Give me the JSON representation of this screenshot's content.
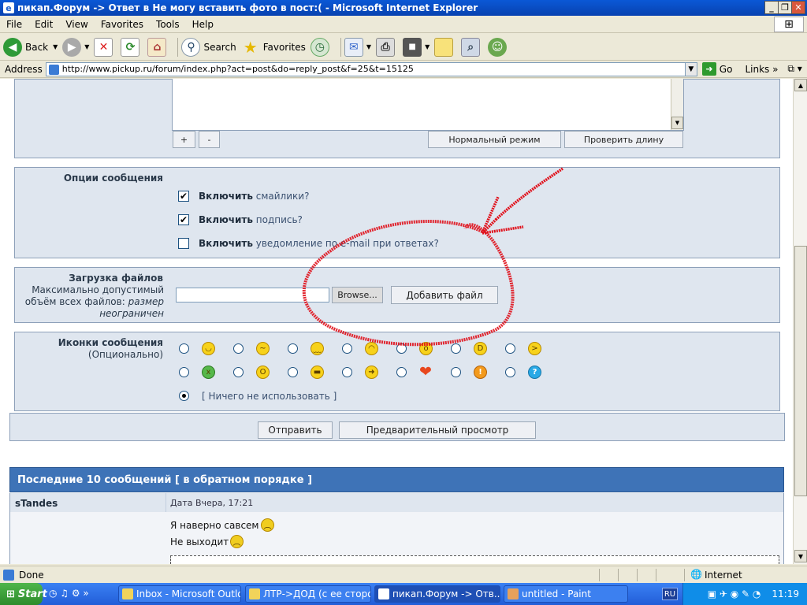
{
  "window": {
    "title": "пикап.Форум -> Ответ в Не могу вставить фото в пост:( - Microsoft Internet Explorer",
    "controls": [
      "_",
      "❐",
      "✕"
    ]
  },
  "menu": [
    "File",
    "Edit",
    "View",
    "Favorites",
    "Tools",
    "Help"
  ],
  "toolbar": {
    "back": "Back",
    "search": "Search",
    "favorites": "Favorites"
  },
  "address": {
    "label": "Address",
    "url": "http://www.pickup.ru/forum/index.php?act=post&do=reply_post&f=25&t=15125",
    "go": "Go",
    "links": "Links"
  },
  "editor": {
    "plus": "+",
    "minus": "-",
    "normal_mode": "Нормальный режим",
    "check_length": "Проверить длину"
  },
  "options": {
    "title": "Опции сообщения",
    "items": [
      {
        "bold": "Включить",
        "rest": " смайлики?",
        "checked": true
      },
      {
        "bold": "Включить",
        "rest": " подпись?",
        "checked": true
      },
      {
        "bold": "Включить",
        "rest": " уведомление по e-mail при ответах?",
        "checked": false
      }
    ]
  },
  "upload": {
    "title": "Загрузка файлов",
    "desc1": "Максимально допустимый",
    "desc2": "объём всех файлов:",
    "desc2_em": "размер",
    "desc3": "неограничен",
    "browse": "Browse...",
    "add": "Добавить файл"
  },
  "icons": {
    "title": "Иконки сообщения",
    "subtitle": "(Опционально)",
    "none": "[ Ничего не использовать ]"
  },
  "submit": {
    "send": "Отправить",
    "preview": "Предварительный просмотр"
  },
  "recent": {
    "header": "Последние 10 сообщений [ в обратном порядке ]",
    "author": "sTandes",
    "date": "Дата Вчера, 17:21",
    "line1": "Я наверно савсем",
    "line2": "Не выходит"
  },
  "status": {
    "done": "Done",
    "zone": "Internet"
  },
  "taskbar": {
    "start": "Start",
    "items": [
      "Inbox - Microsoft Outlook",
      "ЛТР->ДОД (с ее сторон...",
      "пикап.Форум -> Отв...",
      "untitled - Paint"
    ],
    "lang": "RU",
    "clock": "11:19"
  },
  "colors": {
    "panel_bg": "#dfe6ef",
    "header_blue": "#3e73b7",
    "annotation_red": "#e0101a"
  }
}
